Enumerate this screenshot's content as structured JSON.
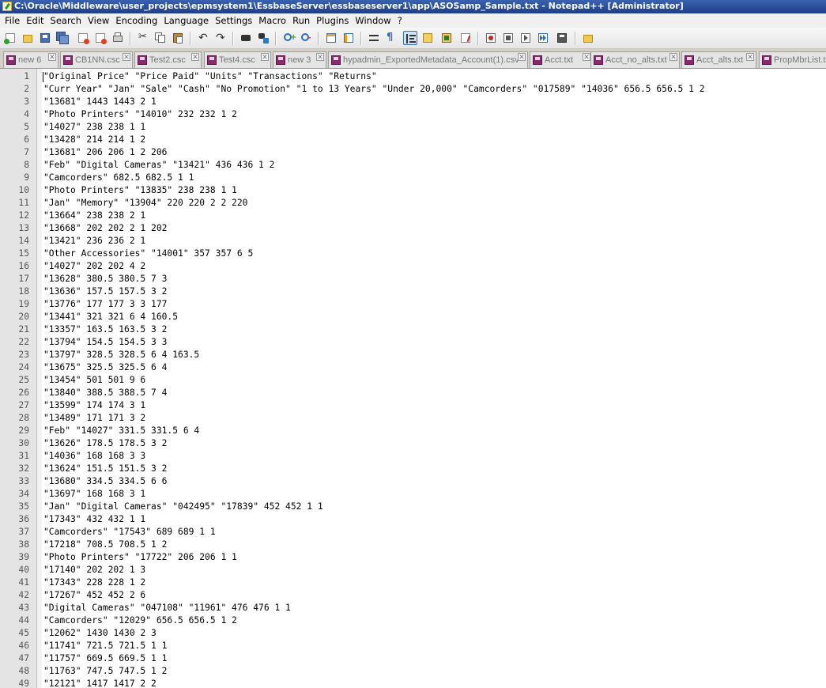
{
  "window": {
    "title": "C:\\Oracle\\Middleware\\user_projects\\epmsystem1\\EssbaseServer\\essbaseserver1\\app\\ASOSamp_Sample.txt - Notepad++ [Administrator]"
  },
  "menu": [
    "File",
    "Edit",
    "Search",
    "View",
    "Encoding",
    "Language",
    "Settings",
    "Macro",
    "Run",
    "Plugins",
    "Window",
    "?"
  ],
  "toolbar": {
    "icons": [
      "new-file-icon",
      "open-file-icon",
      "save-icon",
      "save-all-icon",
      "close-icon",
      "close-all-icon",
      "print-icon",
      "cut-icon",
      "copy-icon",
      "paste-icon",
      "undo-icon",
      "redo-icon",
      "find-icon",
      "replace-icon",
      "zoom-in-icon",
      "zoom-out-icon",
      "sync-vertical-icon",
      "sync-horizontal-icon",
      "word-wrap-icon",
      "show-all-chars-icon",
      "indent-guide-icon",
      "user-lang-icon",
      "doc-map-icon",
      "function-list-icon",
      "record-macro-icon",
      "stop-macro-icon",
      "play-macro-icon",
      "run-macro-multiple-icon",
      "save-macro-icon",
      "folder-workspace-icon"
    ]
  },
  "tabs": [
    {
      "label": "new 6"
    },
    {
      "label": "CB1NN.csc"
    },
    {
      "label": "Test2.csc"
    },
    {
      "label": "Test4.csc"
    },
    {
      "label": "new 3"
    },
    {
      "label": "hypadmin_ExportedMetadata_Account(1).csv"
    },
    {
      "label": "Acct.txt"
    },
    {
      "label": "Acct_no_alts.txt"
    },
    {
      "label": "Acct_alts.txt"
    },
    {
      "label": "PropMbrList.txt"
    }
  ],
  "editor": {
    "lines": [
      {
        "n": "1",
        "text": "\"Original Price\" \"Price Paid\" \"Units\" \"Transactions\" \"Returns\""
      },
      {
        "n": "2",
        "text": "\"Curr Year\" \"Jan\" \"Sale\" \"Cash\" \"No Promotion\" \"1 to 13 Years\" \"Under 20,000\" \"Camcorders\" \"017589\" \"14036\" 656.5 656.5 1 2"
      },
      {
        "n": "3",
        "text": "\"13681\" 1443 1443 2 1"
      },
      {
        "n": "4",
        "text": "\"Photo Printers\" \"14010\" 232 232 1 2"
      },
      {
        "n": "5",
        "text": "\"14027\" 238 238 1 1"
      },
      {
        "n": "6",
        "text": "\"13428\" 214 214 1 2"
      },
      {
        "n": "7",
        "text": "\"13681\" 206 206 1 2 206"
      },
      {
        "n": "8",
        "text": "\"Feb\" \"Digital Cameras\" \"13421\" 436 436 1 2"
      },
      {
        "n": "9",
        "text": "\"Camcorders\" 682.5 682.5 1 1"
      },
      {
        "n": "10",
        "text": "\"Photo Printers\" \"13835\" 238 238 1 1"
      },
      {
        "n": "11",
        "text": "\"Jan\" \"Memory\" \"13904\" 220 220 2 2 220"
      },
      {
        "n": "12",
        "text": "\"13664\" 238 238 2 1"
      },
      {
        "n": "13",
        "text": "\"13668\" 202 202 2 1 202"
      },
      {
        "n": "14",
        "text": "\"13421\" 236 236 2 1"
      },
      {
        "n": "15",
        "text": "\"Other Accessories\" \"14001\" 357 357 6 5"
      },
      {
        "n": "16",
        "text": "\"14027\" 202 202 4 2"
      },
      {
        "n": "17",
        "text": "\"13628\" 380.5 380.5 7 3"
      },
      {
        "n": "18",
        "text": "\"13636\" 157.5 157.5 3 2"
      },
      {
        "n": "19",
        "text": "\"13776\" 177 177 3 3 177"
      },
      {
        "n": "20",
        "text": "\"13441\" 321 321 6 4 160.5"
      },
      {
        "n": "21",
        "text": "\"13357\" 163.5 163.5 3 2"
      },
      {
        "n": "22",
        "text": "\"13794\" 154.5 154.5 3 3"
      },
      {
        "n": "23",
        "text": "\"13797\" 328.5 328.5 6 4 163.5"
      },
      {
        "n": "24",
        "text": "\"13675\" 325.5 325.5 6 4"
      },
      {
        "n": "25",
        "text": "\"13454\" 501 501 9 6"
      },
      {
        "n": "26",
        "text": "\"13840\" 388.5 388.5 7 4"
      },
      {
        "n": "27",
        "text": "\"13599\" 174 174 3 1"
      },
      {
        "n": "28",
        "text": "\"13489\" 171 171 3 2"
      },
      {
        "n": "29",
        "text": "\"Feb\" \"14027\" 331.5 331.5 6 4"
      },
      {
        "n": "30",
        "text": "\"13626\" 178.5 178.5 3 2"
      },
      {
        "n": "31",
        "text": "\"14036\" 168 168 3 3"
      },
      {
        "n": "32",
        "text": "\"13624\" 151.5 151.5 3 2"
      },
      {
        "n": "33",
        "text": "\"13680\" 334.5 334.5 6 6"
      },
      {
        "n": "34",
        "text": "\"13697\" 168 168 3 1"
      },
      {
        "n": "35",
        "text": "\"Jan\" \"Digital Cameras\" \"042495\" \"17839\" 452 452 1 1"
      },
      {
        "n": "36",
        "text": "\"17343\" 432 432 1 1"
      },
      {
        "n": "37",
        "text": "\"Camcorders\" \"17543\" 689 689 1 1"
      },
      {
        "n": "38",
        "text": "\"17218\" 708.5 708.5 1 2"
      },
      {
        "n": "39",
        "text": "\"Photo Printers\" \"17722\" 206 206 1 1"
      },
      {
        "n": "40",
        "text": "\"17140\" 202 202 1 3"
      },
      {
        "n": "41",
        "text": "\"17343\" 228 228 1 2"
      },
      {
        "n": "42",
        "text": "\"17267\" 452 452 2 6"
      },
      {
        "n": "43",
        "text": "\"Digital Cameras\" \"047108\" \"11961\" 476 476 1 1"
      },
      {
        "n": "44",
        "text": "\"Camcorders\" \"12029\" 656.5 656.5 1 2"
      },
      {
        "n": "45",
        "text": "\"12062\" 1430 1430 2 3"
      },
      {
        "n": "46",
        "text": "\"11741\" 721.5 721.5 1 1"
      },
      {
        "n": "47",
        "text": "\"11757\" 669.5 669.5 1 1"
      },
      {
        "n": "48",
        "text": "\"11763\" 747.5 747.5 1 2"
      },
      {
        "n": "49",
        "text": "\"12121\" 1417 1417 2 2"
      }
    ]
  },
  "colors": {
    "titlebar": "#2a4f9c",
    "line_number_bg": "#e4e4e4",
    "tab_text": "#777777"
  }
}
